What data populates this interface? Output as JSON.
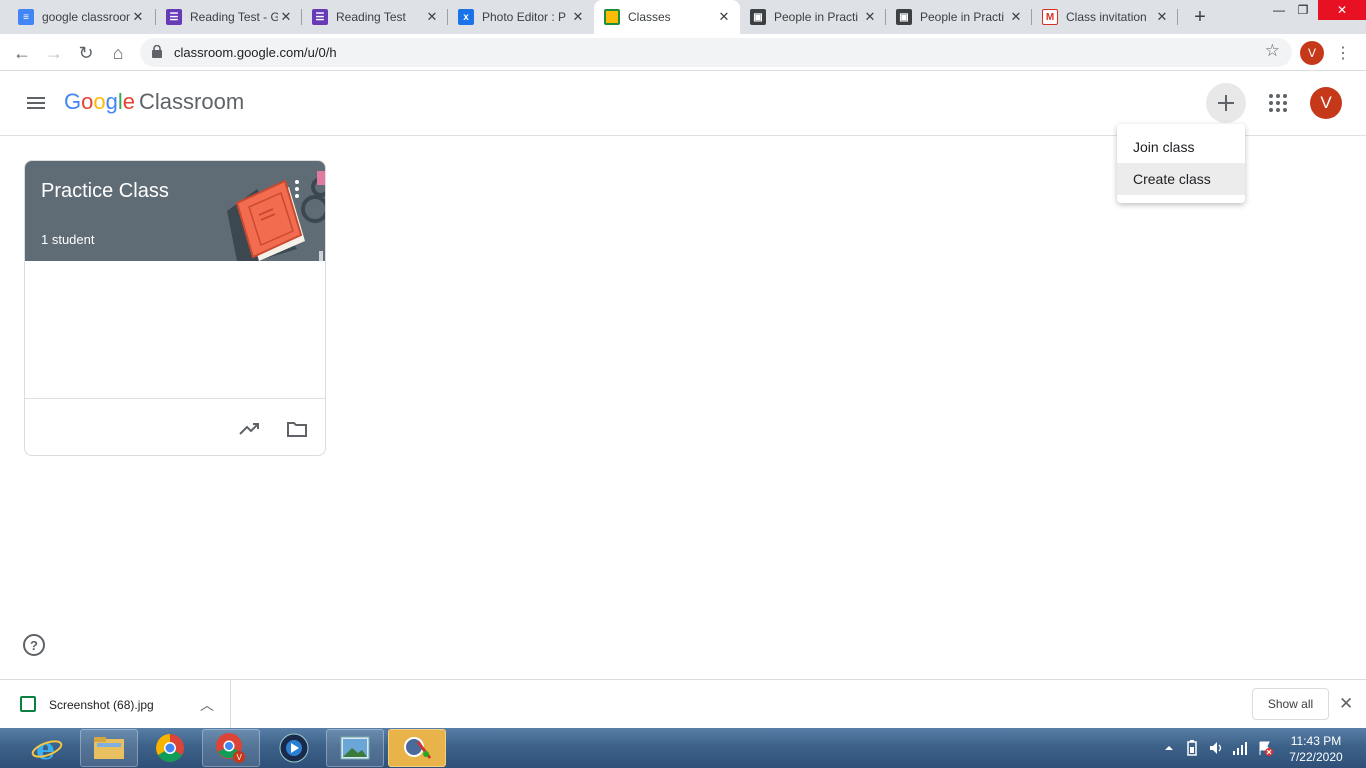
{
  "browser": {
    "tabs": [
      {
        "label": "google classroom",
        "icon": "docs-icon",
        "color": "#4285f4",
        "active": false
      },
      {
        "label": "Reading Test - G",
        "icon": "forms-icon",
        "color": "#673ab7",
        "active": false
      },
      {
        "label": "Reading Test",
        "icon": "forms-icon",
        "color": "#673ab7",
        "active": false
      },
      {
        "label": "Photo Editor : P",
        "icon": "pixlr-icon",
        "color": "#1a73e8",
        "active": false
      },
      {
        "label": "Classes",
        "icon": "classroom-icon",
        "color": "#1e8e3e",
        "active": true
      },
      {
        "label": "People in Practi",
        "icon": "classroom-people-icon",
        "color": "#3c4043",
        "active": false
      },
      {
        "label": "People in Practi",
        "icon": "classroom-people-icon",
        "color": "#3c4043",
        "active": false
      },
      {
        "label": "Class invitation",
        "icon": "gmail-icon",
        "color": "#d93025",
        "active": false
      }
    ],
    "url": "classroom.google.com/u/0/h",
    "profile_initial": "V"
  },
  "app": {
    "brand_google": [
      "G",
      "o",
      "o",
      "g",
      "l",
      "e"
    ],
    "brand_product": "Classroom",
    "avatar_initial": "V",
    "avatar_color": "#c5381a"
  },
  "dropdown": {
    "items": [
      {
        "label": "Join class"
      },
      {
        "label": "Create class"
      }
    ]
  },
  "class_card": {
    "title": "Practice Class",
    "subtitle": "1 student",
    "header_color": "#5f6c76"
  },
  "downloads": {
    "file_name": "Screenshot (68).jpg",
    "show_all_label": "Show all"
  },
  "taskbar": {
    "time": "11:43 PM",
    "date": "7/22/2020"
  }
}
